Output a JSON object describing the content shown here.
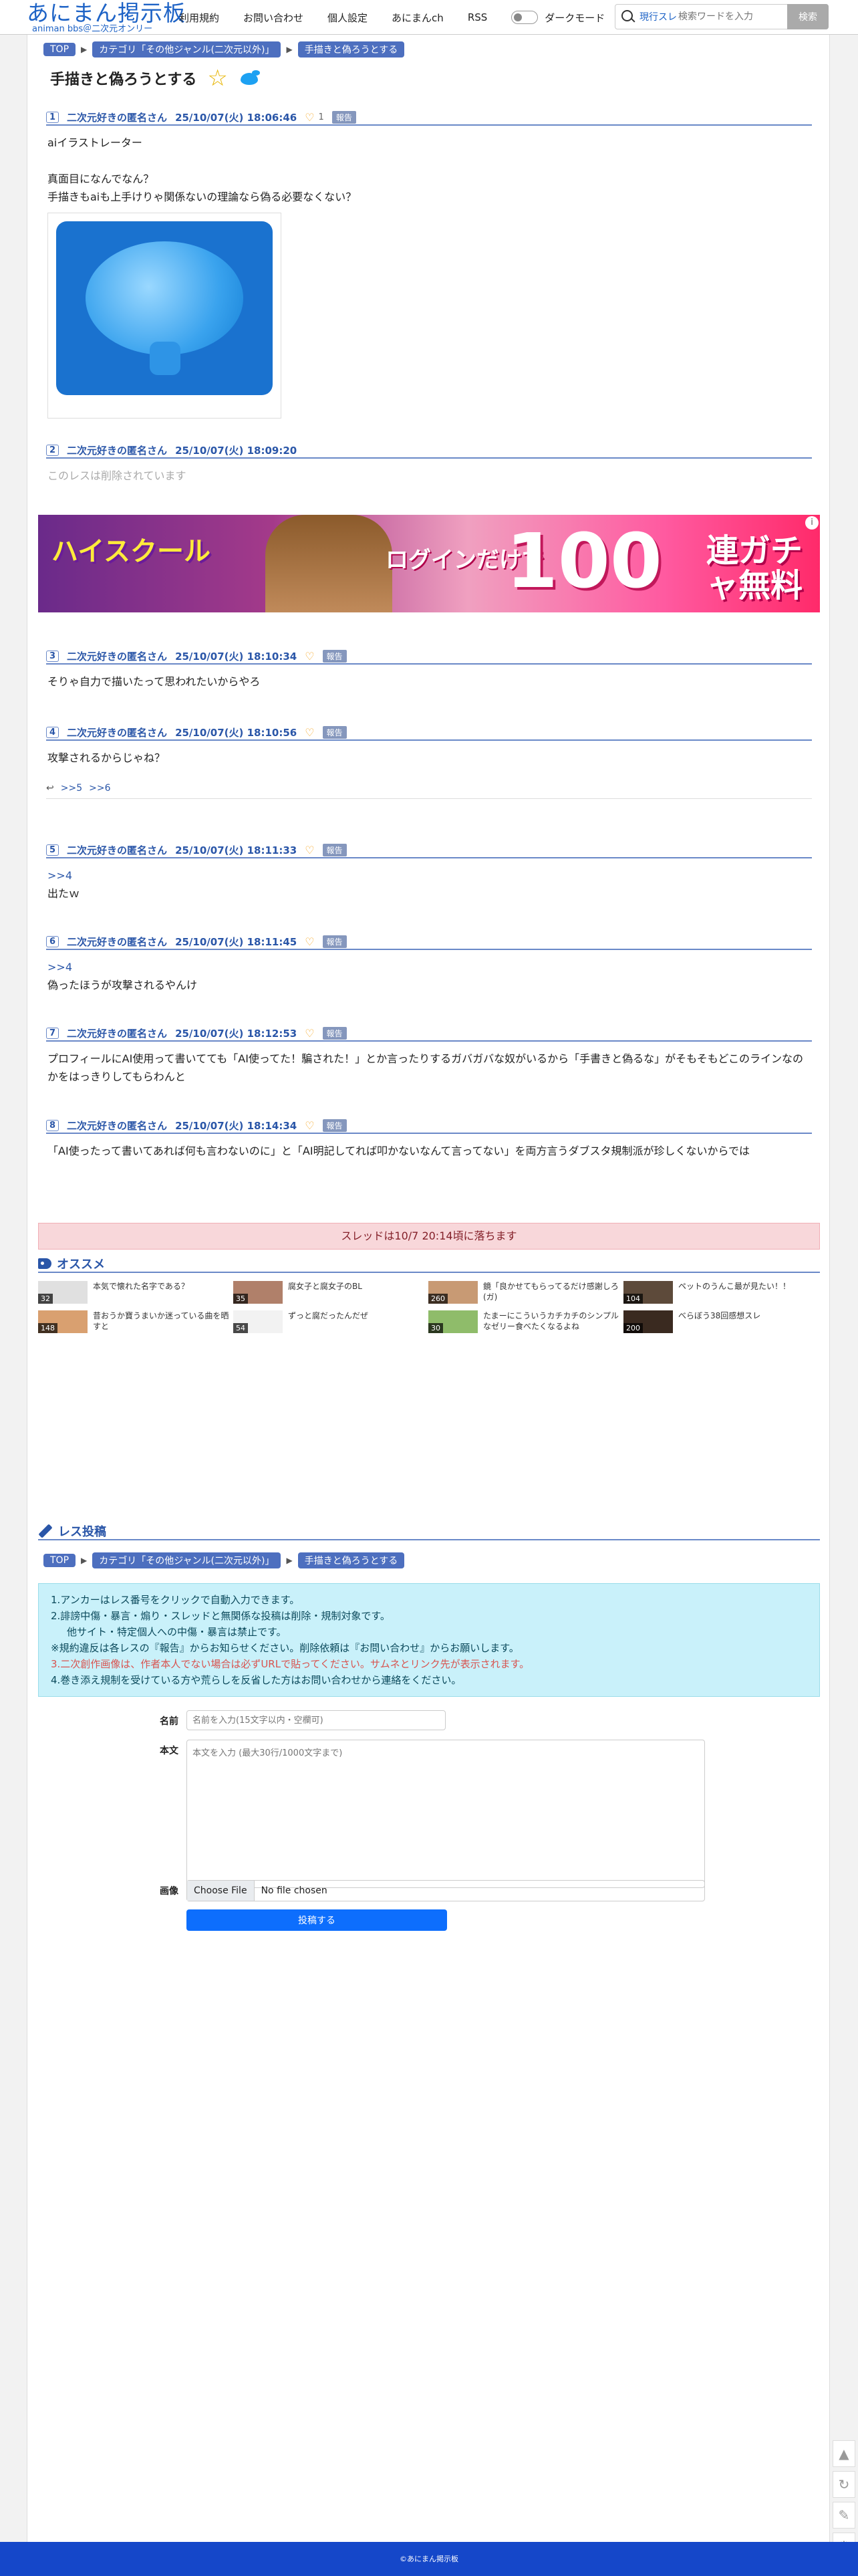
{
  "header": {
    "logo_main": "あにまん掲示板",
    "logo_sub": "animan bbs＠二次元オンリー",
    "nav": [
      "利用規約",
      "お問い合わせ",
      "個人設定",
      "あにまんch",
      "RSS"
    ],
    "dark_mode_label": "ダークモード",
    "search_type": "現行スレ",
    "search_placeholder": "検索ワードを入力",
    "search_button": "検索"
  },
  "breadcrumb": [
    "TOP",
    "カテゴリ「その他ジャンル(二次元以外)」",
    "手描きと偽ろうとする"
  ],
  "thread": {
    "title": "手描きと偽ろうとする"
  },
  "posts": [
    {
      "num": "1",
      "name": "二次元好きの匿名さん",
      "date": "25/10/07(火) 18:06:46",
      "likes": "1",
      "report": "報告",
      "body": [
        "aiイラストレーター",
        "",
        "真面目になんでなん？",
        "手描きもaiも上手けりゃ関係ないの理論なら偽る必要なくない？"
      ]
    },
    {
      "num": "2",
      "name": "二次元好きの匿名さん",
      "date": "25/10/07(火) 18:09:20",
      "body": [
        "このレスは削除されています"
      ]
    },
    {
      "num": "3",
      "name": "二次元好きの匿名さん",
      "date": "25/10/07(火) 18:10:34",
      "report": "報告",
      "body": [
        "そりゃ自力で描いたって思われたいからやろ"
      ]
    },
    {
      "num": "4",
      "name": "二次元好きの匿名さん",
      "date": "25/10/07(火) 18:10:56",
      "report": "報告",
      "body": [
        "攻撃されるからじゃね？"
      ],
      "replies": [
        ">>5",
        ">>6"
      ]
    },
    {
      "num": "5",
      "name": "二次元好きの匿名さん",
      "date": "25/10/07(火) 18:11:33",
      "report": "報告",
      "anchor": ">>4",
      "body": [
        "出たｗ"
      ]
    },
    {
      "num": "6",
      "name": "二次元好きの匿名さん",
      "date": "25/10/07(火) 18:11:45",
      "report": "報告",
      "anchor": ">>4",
      "body": [
        "偽ったほうが攻撃されるやんけ"
      ]
    },
    {
      "num": "7",
      "name": "二次元好きの匿名さん",
      "date": "25/10/07(火) 18:12:53",
      "report": "報告",
      "body": [
        "プロフィールにAI使用って書いてても「AI使ってた！騙された！」とか言ったりするガバガバな奴がいるから「手書きと偽るな」がそもそもどこのラインなのかをはっきりしてもらわんと"
      ]
    },
    {
      "num": "8",
      "name": "二次元好きの匿名さん",
      "date": "25/10/07(火) 18:14:34",
      "report": "報告",
      "body": [
        "「AI使ったって書いてあれば何も言わないのに」と「AI明記してれば叩かないなんて言ってない」を両方言うダブスタ規制派が珍しくないからでは"
      ]
    }
  ],
  "banner": {
    "logo": "ハイスクール",
    "sub": "ログインだけで",
    "big": "100",
    "right": "連ガチャ無料"
  },
  "expire_notice": "スレッドは10/7 20:14頃に落ちます",
  "recommend": {
    "title": "オススメ",
    "items": [
      {
        "count": "32",
        "text": "本気で懐れた名字である？"
      },
      {
        "count": "35",
        "text": "腐女子と腐女子のBL"
      },
      {
        "count": "260",
        "text": "鏡「良かせてもらってるだけ感謝しろ(ガ)"
      },
      {
        "count": "104",
        "text": "ペットのうんこ最が見たい！！"
      },
      {
        "count": "148",
        "text": "昔おうか寶うまいか迷っている曲を晒すと"
      },
      {
        "count": "54",
        "text": "ずっと腐だったんだぜ"
      },
      {
        "count": "30",
        "text": "たまーにこういうカチカチのシンプルなゼリー食べたくなるよね"
      },
      {
        "count": "200",
        "text": "べらぼう38回感想スレ"
      }
    ]
  },
  "form": {
    "title": "レス投稿",
    "rules": [
      "1.アンカーはレス番号をクリックで自動入力できます。",
      "2.誹謗中傷・暴言・煽り・スレッドと無関係な投稿は削除・規制対象です。",
      "他サイト・特定個人への中傷・暴言は禁止です。",
      "※規約違反は各レスの『報告』からお知らせください。削除依頼は『お問い合わせ』からお願いします。",
      "3.二次創作画像は、作者本人でない場合は必ずURLで貼ってください。サムネとリンク先が表示されます。",
      "4.巻き添え規制を受けている方や荒らしを反省した方はお問い合わせから連絡をください。"
    ],
    "name_label": "名前",
    "name_placeholder": "名前を入力(15文字以内・空欄可)",
    "body_label": "本文",
    "body_placeholder": "本文を入力 (最大30行/1000文字まで)",
    "image_label": "画像",
    "file_button": "Choose File",
    "file_name": "No file chosen",
    "submit": "投稿する"
  },
  "footer": "©あにまん掲示板"
}
